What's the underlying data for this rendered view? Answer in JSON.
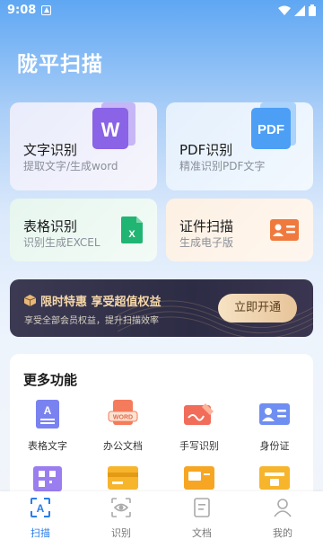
{
  "status_bar": {
    "time": "9:08"
  },
  "page_title": "陇平扫描",
  "cards": {
    "text_recognition": {
      "title": "文字识别",
      "subtitle": "提取文字/生成word",
      "icon_letter": "W"
    },
    "pdf_recognition": {
      "title": "PDF识别",
      "subtitle": "精准识别PDF文字",
      "icon_letter": "PDF"
    },
    "table_recognition": {
      "title": "表格识别",
      "subtitle": "识别生成EXCEL",
      "icon_letter": "X"
    },
    "id_scan": {
      "title": "证件扫描",
      "subtitle": "生成电子版"
    }
  },
  "promo": {
    "title": "限时特惠 享受超值权益",
    "subtitle": "享受全部会员权益，提升扫描效率",
    "button": "立即开通"
  },
  "more": {
    "title": "更多功能",
    "items": [
      {
        "label": "表格文字",
        "icon": "table-text-icon"
      },
      {
        "label": "办公文档",
        "icon": "word-document-icon",
        "badge": "WORD"
      },
      {
        "label": "手写识别",
        "icon": "handwriting-icon"
      },
      {
        "label": "身份证",
        "icon": "id-card-icon"
      }
    ],
    "row2_icons": [
      "qr-code-icon",
      "bank-card-icon",
      "card-scan-icon",
      "license-icon"
    ]
  },
  "tabs": [
    {
      "label": "扫描",
      "active": true
    },
    {
      "label": "识别",
      "active": false
    },
    {
      "label": "文档",
      "active": false
    },
    {
      "label": "我的",
      "active": false
    }
  ],
  "colors": {
    "accent": "#2b7de9",
    "promo_gold": "#f6d7a8"
  }
}
